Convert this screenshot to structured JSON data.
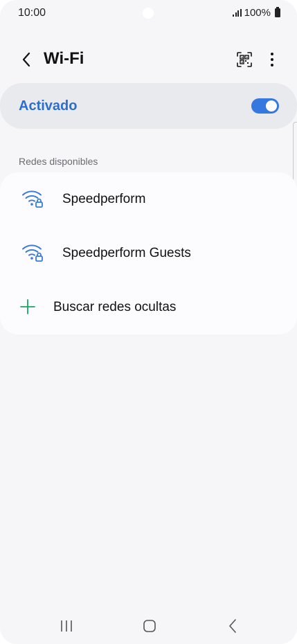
{
  "status_bar": {
    "time": "10:00",
    "battery_text": "100%",
    "icons": [
      "signal-icon",
      "battery-icon"
    ]
  },
  "header": {
    "title": "Wi-Fi",
    "icons": [
      "back-icon",
      "qr-code-icon",
      "more-options-icon"
    ]
  },
  "master_switch": {
    "label": "Activado",
    "enabled": true,
    "accent_color": "#3478e0",
    "label_color": "#2c6dd0"
  },
  "networks": {
    "section_title": "Redes disponibles",
    "items": [
      {
        "name": "Speedperform",
        "icon": "wifi-locked-icon"
      },
      {
        "name": "Speedperform Guests",
        "icon": "wifi-locked-icon"
      }
    ],
    "add_hidden_label": "Buscar redes ocultas",
    "add_icon": "plus-icon",
    "add_icon_color": "#19a463"
  },
  "nav_bar": {
    "icons": [
      "recent-apps-icon",
      "home-icon",
      "back-nav-icon"
    ]
  }
}
